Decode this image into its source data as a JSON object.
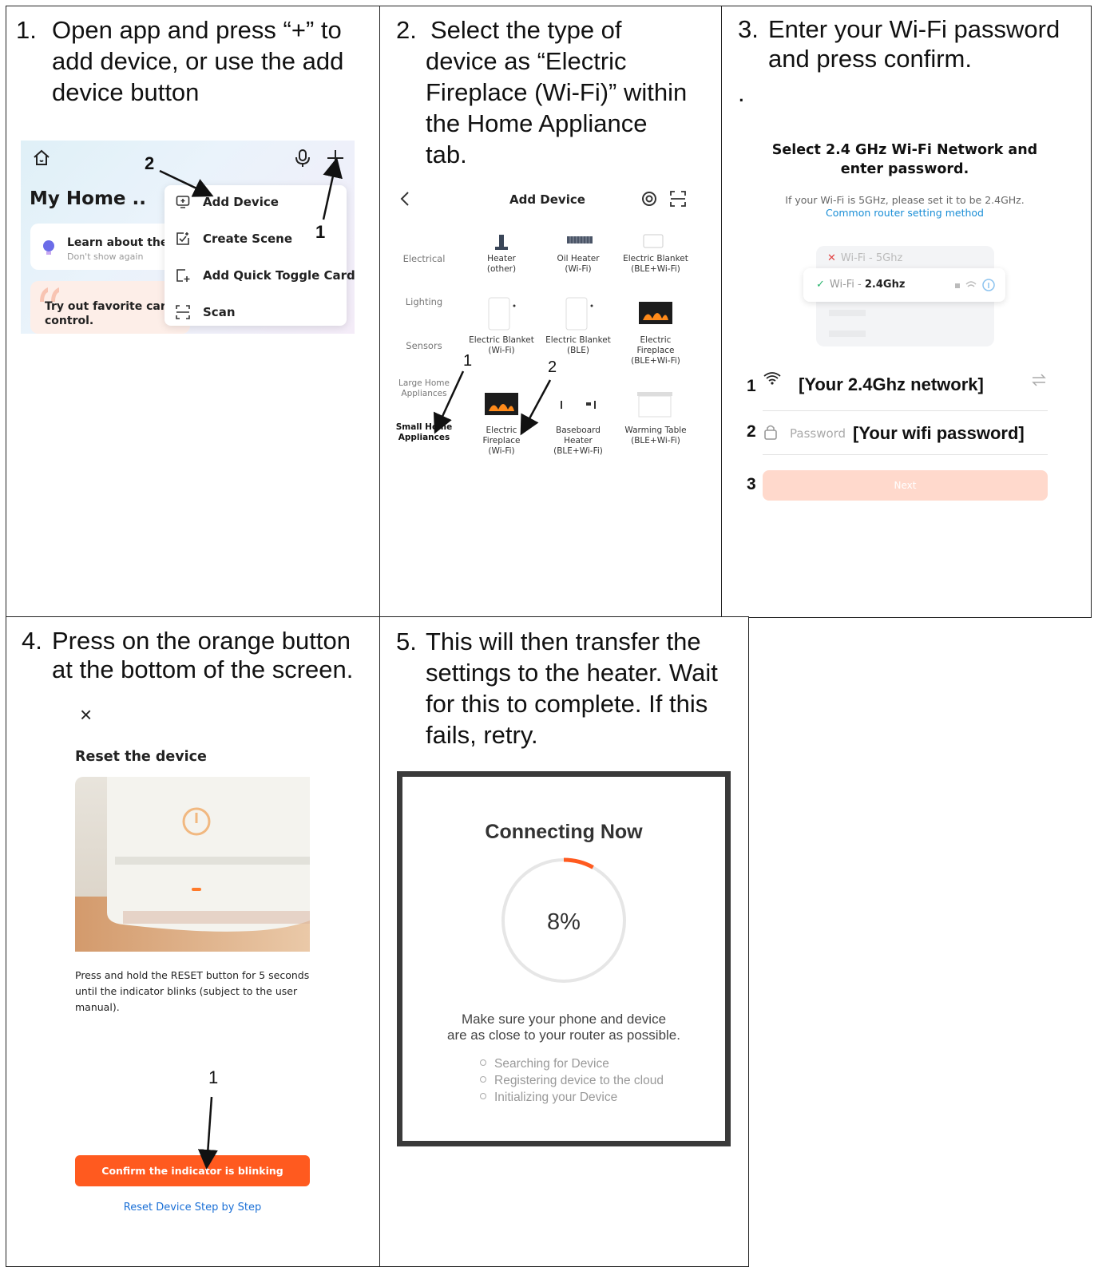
{
  "steps": [
    {
      "num": "1.",
      "lines": [
        "Open app and press “+” to",
        "add device, or use the add",
        "device button"
      ]
    },
    {
      "num": "2.",
      "lines": [
        "Select the type of",
        "device as “Electric",
        "Fireplace (Wi-Fi)” within",
        "the Home Appliance",
        "tab."
      ]
    },
    {
      "num": "3.",
      "lines": [
        "Enter your Wi-Fi password",
        "and press confirm."
      ],
      "dot": "."
    },
    {
      "num": "4.",
      "lines": [
        "Press on the orange button",
        "at the bottom of the screen."
      ]
    },
    {
      "num": "5.",
      "lines": [
        "This will then transfer the",
        "settings to the heater. Wait",
        "for this to complete. If this",
        "fails, retry."
      ]
    }
  ],
  "panel1": {
    "title": "My Home ..",
    "learn": "Learn about the",
    "dont_show": "Don't show again",
    "try_out_1": "Try out favorite card",
    "try_out_2": "control.",
    "menu": [
      "Add Device",
      "Create Scene",
      "Add Quick Toggle Card",
      "Scan"
    ],
    "annot_1": "1",
    "annot_2": "2",
    "icons": [
      "home-icon",
      "microphone-icon",
      "plus-icon",
      "add-device-icon",
      "create-scene-icon",
      "toggle-card-icon",
      "scan-icon",
      "bulb-icon",
      "quote-icon"
    ]
  },
  "panel2": {
    "title": "Add Device",
    "categories": [
      "Electrical",
      "Lighting",
      "Sensors",
      "Large Home\nAppliances",
      "Small Home\nAppliances"
    ],
    "devices": [
      {
        "name": "Heater\n(other)"
      },
      {
        "name": "Oil Heater\n(Wi-Fi)"
      },
      {
        "name": "Electric Blanket\n(BLE+Wi-Fi)"
      },
      {
        "name": "Electric Blanket\n(Wi-Fi)"
      },
      {
        "name": "Electric Blanket\n(BLE)"
      },
      {
        "name": "Electric\nFireplace\n(BLE+Wi-Fi)"
      },
      {
        "name": "Electric\nFireplace\n(Wi-Fi)"
      },
      {
        "name": "Baseboard\nHeater\n(BLE+Wi-Fi)"
      },
      {
        "name": "Warming Table\n(BLE+Wi-Fi)"
      }
    ],
    "annot_1": "1",
    "annot_2": "2",
    "icons": [
      "back-icon",
      "target-icon",
      "scan-icon"
    ]
  },
  "panel3": {
    "heading_1": "Select 2.4 GHz Wi-Fi Network and",
    "heading_2": "enter password.",
    "hint": "If your Wi-Fi is 5GHz, please set it to be 2.4GHz.",
    "link": "Common router setting method",
    "wifi_5g_label": "Wi-Fi - 5Ghz",
    "wifi_24_prefix": "Wi-Fi - ",
    "wifi_24_bold": "2.4Ghz",
    "network_placeholder": "[Your 2.4Ghz network]",
    "password_label": "Password",
    "password_value": "[Your wifi password]",
    "next_label": "Next",
    "annot_1": "1",
    "annot_2": "2",
    "annot_3": "3",
    "accent_color": "#ffd9cc"
  },
  "panel4": {
    "close": "×",
    "title": "Reset the device",
    "desc_1": "Press and hold the RESET button for 5 seconds",
    "desc_2": "until the indicator blinks (subject to the user",
    "desc_3": "manual).",
    "confirm_label": "Confirm the indicator is blinking",
    "reset_link": "Reset Device Step by Step",
    "annot_1": "1",
    "accent_color": "#ff5a1f"
  },
  "panel5": {
    "title": "Connecting Now",
    "progress_text": "8%",
    "progress_fraction": 0.08,
    "msg_1": "Make sure your phone and device",
    "msg_2": "are as close to your router as possible.",
    "list": [
      "Searching for Device",
      "Registering device to the cloud",
      "Initializing your Device"
    ],
    "accent_color": "#ff5a1f"
  }
}
